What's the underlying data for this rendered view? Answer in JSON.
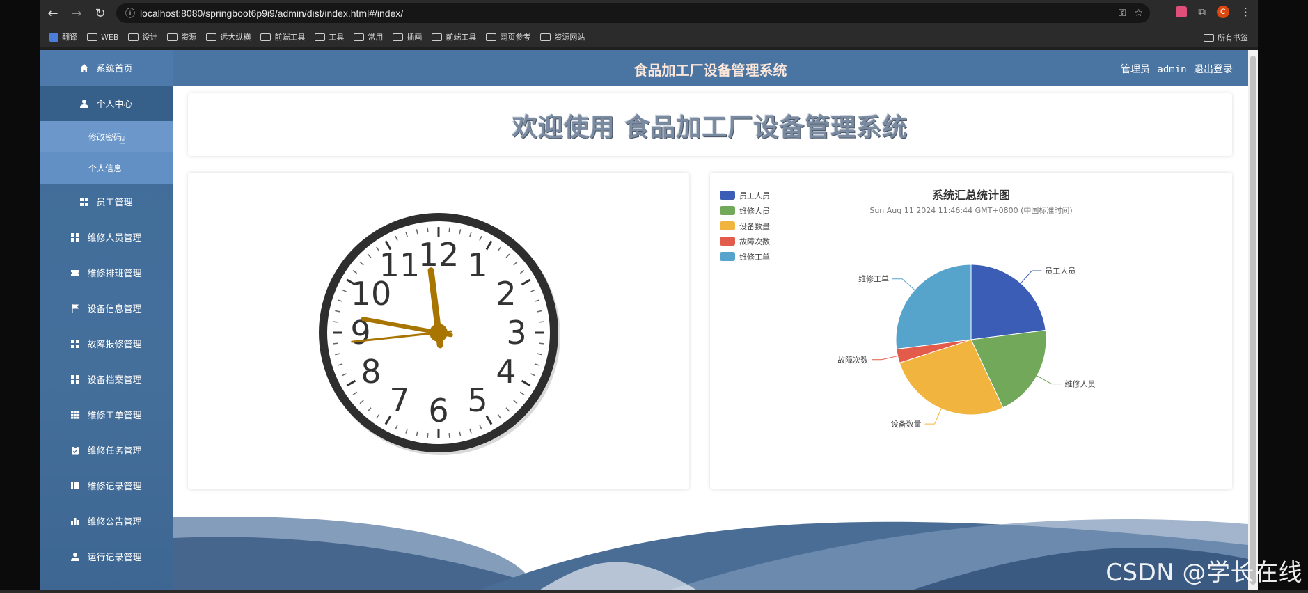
{
  "browser": {
    "url": "localhost:8080/springboot6p9i9/admin/dist/index.html#/index/",
    "profile_initial": "C",
    "bookmarks": [
      "翻译",
      "WEB",
      "设计",
      "资源",
      "远大纵横",
      "前端工具",
      "工具",
      "常用",
      "插画",
      "前端工具",
      "网页参考",
      "资源网站"
    ],
    "all_bookmarks": "所有书签"
  },
  "header": {
    "title": "食品加工厂设备管理系统",
    "role": "管理员",
    "username": "admin",
    "logout": "退出登录"
  },
  "sidebar": {
    "items": [
      {
        "label": "系统首页",
        "icon": "home-icon"
      },
      {
        "label": "个人中心",
        "icon": "user-icon"
      },
      {
        "label": "修改密码",
        "icon": ""
      },
      {
        "label": "个人信息",
        "icon": ""
      },
      {
        "label": "员工管理",
        "icon": "grid-icon"
      },
      {
        "label": "维修人员管理",
        "icon": "grid-icon"
      },
      {
        "label": "维修排班管理",
        "icon": "ticket-icon"
      },
      {
        "label": "设备信息管理",
        "icon": "flag-icon"
      },
      {
        "label": "故障报修管理",
        "icon": "grid-icon"
      },
      {
        "label": "设备档案管理",
        "icon": "grid-icon"
      },
      {
        "label": "维修工单管理",
        "icon": "table-icon"
      },
      {
        "label": "维修任务管理",
        "icon": "clipboard-icon"
      },
      {
        "label": "维修记录管理",
        "icon": "book-icon"
      },
      {
        "label": "维修公告管理",
        "icon": "bar-chart-icon"
      },
      {
        "label": "运行记录管理",
        "icon": "user-icon"
      }
    ]
  },
  "welcome": {
    "text": "欢迎使用 食品加工厂设备管理系统"
  },
  "clock": {
    "hours": 11,
    "minutes": 46,
    "seconds": 44,
    "numbers": [
      "12",
      "1",
      "2",
      "3",
      "4",
      "5",
      "6",
      "7",
      "8",
      "9",
      "10",
      "11"
    ]
  },
  "chart_data": {
    "type": "pie",
    "title": "系统汇总统计图",
    "subtitle": "Sun Aug 11 2024 11:46:44 GMT+0800 (中国标准时间)",
    "legend_position": "top-left",
    "categories": [
      "员工人员",
      "维修人员",
      "设备数量",
      "故障次数",
      "维修工单"
    ],
    "values": [
      23,
      20,
      27,
      3,
      27
    ],
    "colors": [
      "#3b5db5",
      "#72a85a",
      "#f0b43f",
      "#e35b4b",
      "#56a3cc"
    ]
  },
  "watermark": "CSDN @学长在线"
}
